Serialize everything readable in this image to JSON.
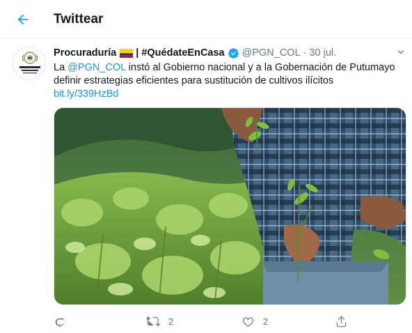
{
  "header": {
    "back_icon": "arrow-left-icon",
    "title": "Twittear"
  },
  "tweet": {
    "display_name": "Procuraduría",
    "name_extra": "| #QuédateEnCasa",
    "flag_icon": "colombia-flag-icon",
    "verified_icon": "verified-badge-icon",
    "handle": "@PGN_COL",
    "separator": "·",
    "date": "30 jul.",
    "text_prefix": "La ",
    "mention": "@PGN_COL",
    "text_rest": " instó al Gobierno nacional y a la Gobernación de Putumayo definir estrategias eficientes para sustitución de cultivos ilícitos",
    "link": "bit.ly/339HzBd",
    "media_description_icon": "photo-coca-field",
    "actions": {
      "reply_count": "",
      "retweet_count": "2",
      "like_count": "2"
    }
  },
  "colors": {
    "accent": "#1da1f2",
    "link": "#1b95e0",
    "muted": "#657786",
    "border": "#e6ecf0"
  }
}
